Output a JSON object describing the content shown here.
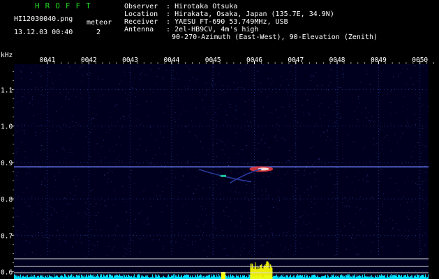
{
  "program_name": "HROFFT",
  "file_name": "HI12030040.png",
  "date_time": "13.12.03 00:40",
  "meteor_label": "meteor",
  "meteor_count": "2",
  "observer": {
    "key": "Observer",
    "value": "Hirotaka Otsuka"
  },
  "location": {
    "key": "Location",
    "value": "Hirakata, Osaka, Japan (135.7E, 34.9N)"
  },
  "receiver": {
    "key": "Receiver",
    "value": "YAESU FT-690 53.749MHz, USB"
  },
  "antenna": {
    "key": "Antenna",
    "value": "2el-HB9CV, 4m's high"
  },
  "antenna_line2": "90-270-Azimuth (East-West), 90-Elevation (Zenith)",
  "y_unit": "kHz",
  "chart_data": {
    "type": "heatmap",
    "title": "",
    "xlabel": "",
    "ylabel": "kHz",
    "x_ticks": [
      "0041",
      "0042",
      "0043",
      "0044",
      "0045",
      "0046",
      "0047",
      "0048",
      "0049",
      "0050"
    ],
    "y_ticks": [
      "1.1",
      "1.0",
      "0.9",
      "0.8",
      "0.7",
      "0.6"
    ],
    "ylim": [
      0.58,
      1.17
    ],
    "carrier_khz": 0.888,
    "meteor_echoes": [
      {
        "time": "00:45:15",
        "freq_khz": 0.862
      },
      {
        "time": "00:46:10",
        "freq_khz": 0.882
      }
    ],
    "colors": {
      "background": "#000030",
      "noise": "#3040a0",
      "echo": "#ff4040",
      "activity_bar": "#00e0ff",
      "activity_peak": "#ffff00"
    }
  }
}
